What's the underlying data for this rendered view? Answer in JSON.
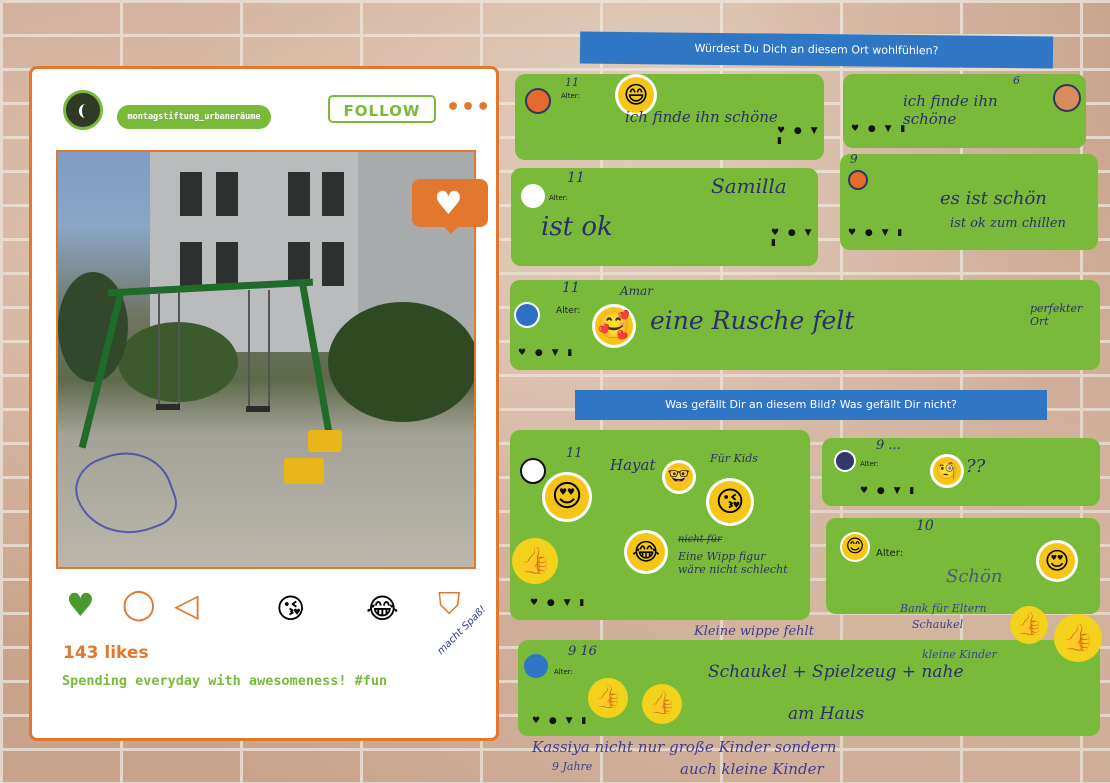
{
  "post": {
    "username": "montagstiftung_urbaneräume",
    "follow_label": "FOLLOW",
    "more_label": "•••",
    "likes": "143 likes",
    "caption": "Spending everyday with awesomeness! #fun",
    "handnote": "macht Spaß!"
  },
  "headers": {
    "q1": "Würdest Du Dich an diesem Ort wohlfühlen?",
    "q2": "Was gefällt Dir an diesem Bild? Was gefällt Dir nicht?"
  },
  "alter_label": "Alter:",
  "icon_row": "♥ ● ▼ ▮",
  "bubbles": {
    "b1": {
      "age": "11",
      "text": "ich finde ihn schöne"
    },
    "b2": {
      "age": "6",
      "text": "ich finde ihn schöne"
    },
    "b3": {
      "age": "11",
      "name": "Samilla",
      "text": "ist ok"
    },
    "b4": {
      "age": "9",
      "text": "es ist schön",
      "text2": "ist ok zum chillen"
    },
    "b5": {
      "age": "11",
      "name": "Amar",
      "text": "eine Rusche felt",
      "text2": "perfekter Ort"
    },
    "b6": {
      "age": "11",
      "name": "Hayat",
      "note_top": "Für Kids",
      "strike": "nicht für",
      "text": "Eine Wipp figur wäre nicht schlecht"
    },
    "b7": {
      "age": "9 ...",
      "text": "??"
    },
    "b8": {
      "age": "10",
      "text": "Schön"
    },
    "b9": {
      "age": "9 16",
      "text": "Schaukel + Spielzeug + nahe",
      "text2": "am Haus"
    }
  },
  "loose_notes": {
    "wippe": "Kleine wippe fehlt",
    "bank": "Bank für Eltern",
    "schaukel": "Schaukel",
    "kinder": "kleine Kinder",
    "bottom1": "Kassiya nicht nur große Kinder sondern",
    "bottom2": "auch kleine Kinder",
    "bottom3": "9 Jahre"
  },
  "icons": [
    "heart-icon",
    "comment-icon",
    "send-icon",
    "bookmark-icon"
  ],
  "colors": {
    "accent_orange": "#e2782e",
    "green": "#7aba3a",
    "tape_blue": "#2f76c5"
  }
}
